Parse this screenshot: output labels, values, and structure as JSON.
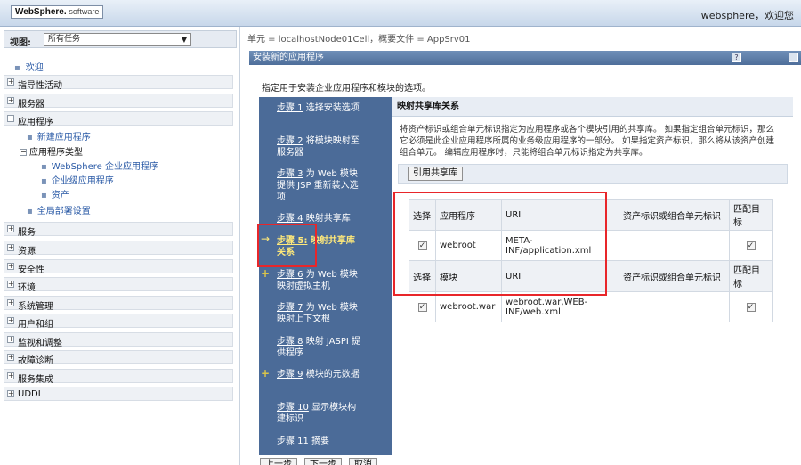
{
  "banner": {
    "logo_brand": "WebSphere.",
    "logo_software": "software",
    "welcome": "websphere，欢迎您"
  },
  "leftnav": {
    "view_label": "视图:",
    "view_value": "所有任务",
    "welcome_link": "欢迎",
    "sections": [
      {
        "label": "指导性活动"
      },
      {
        "label": "服务器"
      },
      {
        "label": "应用程序"
      },
      {
        "label": "服务"
      },
      {
        "label": "资源"
      },
      {
        "label": "安全性"
      },
      {
        "label": "环境"
      },
      {
        "label": "系统管理"
      },
      {
        "label": "用户和组"
      },
      {
        "label": "监视和调整"
      },
      {
        "label": "故障诊断"
      },
      {
        "label": "服务集成"
      },
      {
        "label": "UDDI"
      }
    ],
    "app_sub": {
      "new_app": "新建应用程序",
      "app_types": "应用程序类型",
      "websphere_apps": "WebSphere 企业应用程序",
      "enterprise_apps": "企业级应用程序",
      "assets": "资产",
      "global_deploy": "全局部署设置"
    }
  },
  "main": {
    "breadcrumb": "单元 = localhostNode01Cell，概要文件 = AppSrv01",
    "title": "安装新的应用程序",
    "help_btn": "?",
    "min_btn": "_",
    "intro": "指定用于安装企业应用程序和模块的选项。"
  },
  "steps": [
    {
      "num": "步骤 1",
      "text": "选择安装选项"
    },
    {
      "num": "步骤 2",
      "text": "将模块映射至服务器"
    },
    {
      "num": "步骤 3",
      "text": "为 Web 模块提供 JSP 重新装入选项"
    },
    {
      "num": "步骤 4",
      "text": "映射共享库"
    },
    {
      "num": "步骤 5:",
      "text": "映射共享库关系"
    },
    {
      "num": "步骤 6",
      "text": "为 Web 模块映射虚拟主机"
    },
    {
      "num": "步骤 7",
      "text": "为 Web 模块映射上下文根"
    },
    {
      "num": "步骤 8",
      "text": "映射 JASPI 提供程序"
    },
    {
      "num": "步骤 9",
      "text": "模块的元数据"
    },
    {
      "num": "步骤 10",
      "text": "显示模块构建标识"
    },
    {
      "num": "步骤 11",
      "text": "摘要"
    }
  ],
  "content": {
    "section_title": "映射共享库关系",
    "description": "将资产标识或组合单元标识指定为应用程序或各个模块引用的共享库。 如果指定组合单元标识，那么它必须是此企业应用程序所属的业务级应用程序的一部分。 如果指定资产标识，那么将从该资产创建组合单元。 编辑应用程序时，只能将组合单元标识指定为共享库。",
    "ref_button": "引用共享库",
    "table": {
      "header1": [
        "选择",
        "应用程序",
        "URI",
        "资产标识或组合单元标识",
        "匹配目标"
      ],
      "row1": [
        "webroot",
        "META-INF/application.xml",
        ""
      ],
      "header2": [
        "选择",
        "模块",
        "URI",
        "资产标识或组合单元标识",
        "匹配目标"
      ],
      "row2": [
        "webroot.war",
        "webroot.war,WEB-INF/web.xml",
        ""
      ]
    }
  },
  "bottom": {
    "prev": "上一步",
    "next": "下一步",
    "cancel": "取消"
  },
  "colors": {
    "steps_bg": "#4b6b98",
    "active_step": "#ffe97a",
    "highlight": "#e8262a"
  }
}
